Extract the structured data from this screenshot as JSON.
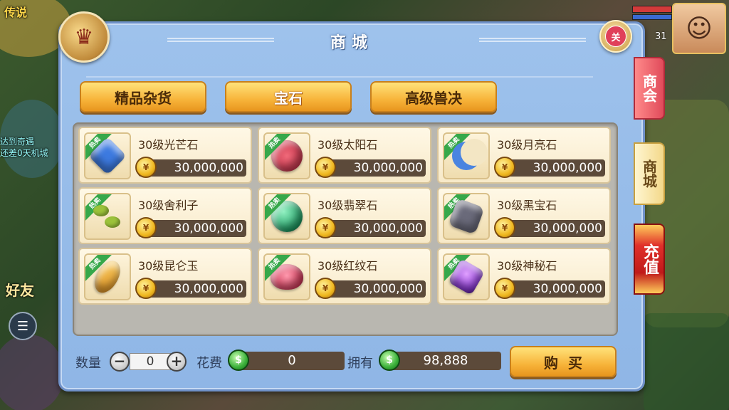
{
  "hud": {
    "top_left_text": "传说",
    "left_line_1": "达到奇遇",
    "left_line_2": "还差0天机城",
    "friend_label": "好友",
    "chat_icon": "chat-bubble-icon",
    "level": "31"
  },
  "dialog": {
    "title": "商城",
    "close_label": "关",
    "emblem_icon": "horse-chariot-icon"
  },
  "categories": [
    {
      "label": "精品杂货"
    },
    {
      "label": "宝石"
    },
    {
      "label": "高级兽决"
    }
  ],
  "hot_label": "热卖",
  "items": [
    {
      "name": "30级光芒石",
      "price": "30,000,000",
      "icon": "guangmang-gem-icon"
    },
    {
      "name": "30级太阳石",
      "price": "30,000,000",
      "icon": "taiyang-gem-icon"
    },
    {
      "name": "30级月亮石",
      "price": "30,000,000",
      "icon": "yueliang-gem-icon"
    },
    {
      "name": "30级舍利子",
      "price": "30,000,000",
      "icon": "sheli-gem-icon"
    },
    {
      "name": "30级翡翠石",
      "price": "30,000,000",
      "icon": "feicui-gem-icon"
    },
    {
      "name": "30级黑宝石",
      "price": "30,000,000",
      "icon": "heibao-gem-icon"
    },
    {
      "name": "30级昆仑玉",
      "price": "30,000,000",
      "icon": "kunlun-gem-icon"
    },
    {
      "name": "30级红纹石",
      "price": "30,000,000",
      "icon": "hongwen-gem-icon"
    },
    {
      "name": "30级神秘石",
      "price": "30,000,000",
      "icon": "shenmi-gem-icon"
    }
  ],
  "coin_glyph": "¥",
  "bottom": {
    "quantity_label": "数量",
    "quantity_value": "0",
    "minus": "−",
    "plus": "+",
    "cost_label": "花费",
    "cost_value": "0",
    "own_label": "拥有",
    "own_value": "98,888",
    "currency_glyph": "$",
    "buy_label": "购买"
  },
  "side_tabs": [
    {
      "label": "商会"
    },
    {
      "label": "商城"
    },
    {
      "label": "充值"
    }
  ]
}
